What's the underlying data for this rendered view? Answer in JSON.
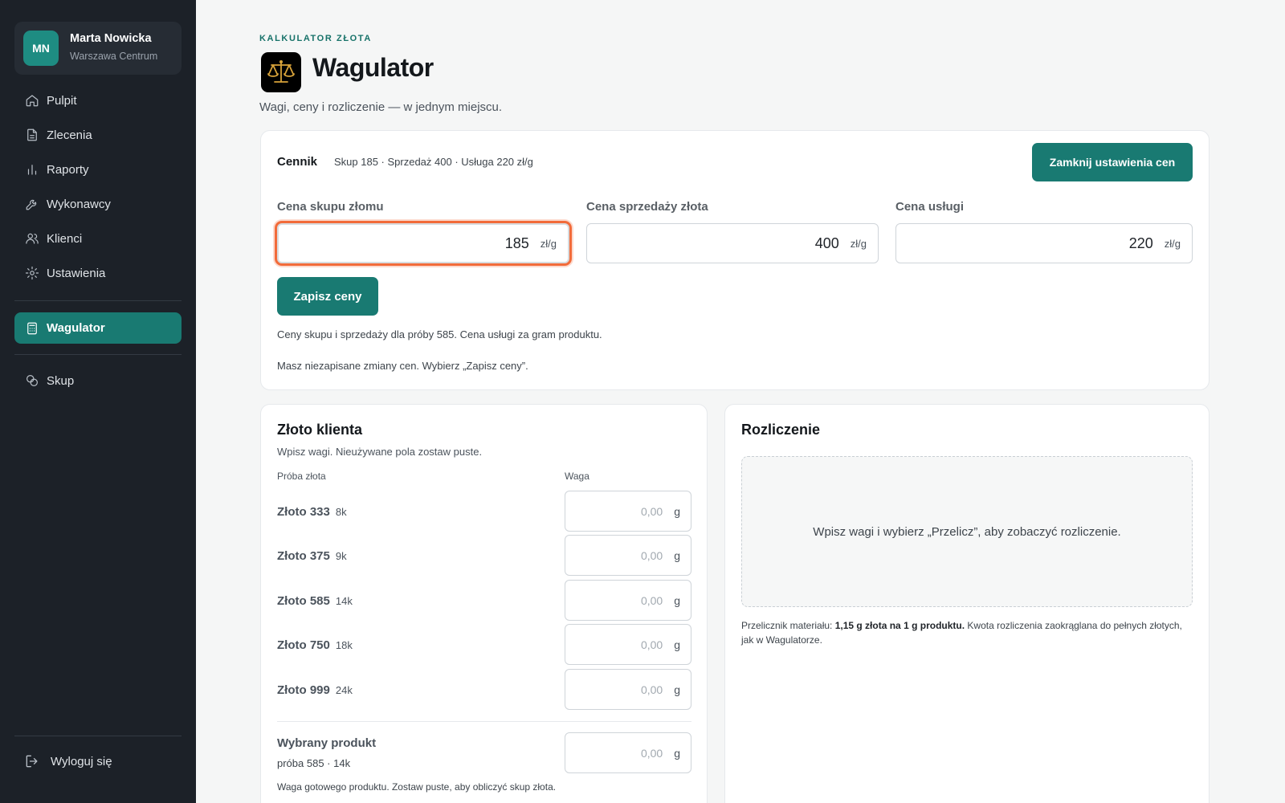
{
  "user": {
    "initials": "MN",
    "name": "Marta Nowicka",
    "location": "Warszawa Centrum"
  },
  "nav": {
    "items": [
      {
        "label": "Pulpit",
        "icon": "home-icon"
      },
      {
        "label": "Zlecenia",
        "icon": "document-icon"
      },
      {
        "label": "Raporty",
        "icon": "chart-icon"
      },
      {
        "label": "Wykonawcy",
        "icon": "wrench-icon"
      },
      {
        "label": "Klienci",
        "icon": "users-icon"
      },
      {
        "label": "Ustawienia",
        "icon": "gear-icon"
      }
    ],
    "active": {
      "label": "Wagulator",
      "icon": "calculator-icon"
    },
    "extra": {
      "label": "Skup",
      "icon": "coins-icon"
    },
    "logout": "Wyloguj się"
  },
  "header": {
    "eyebrow": "KALKULATOR ZŁOTA",
    "title": "Wagulator",
    "subtitle": "Wagi, ceny i rozliczenie — w jednym miejscu."
  },
  "prices": {
    "label": "Cennik",
    "summary": "Skup 185 · Sprzedaż 400 · Usługa 220 zł/g",
    "close_button": "Zamknij ustawienia cen",
    "fields": [
      {
        "label": "Cena skupu złomu",
        "value": "185",
        "unit": "zł/g"
      },
      {
        "label": "Cena sprzedaży złota",
        "value": "400",
        "unit": "zł/g"
      },
      {
        "label": "Cena usługi",
        "value": "220",
        "unit": "zł/g"
      }
    ],
    "save_button": "Zapisz ceny",
    "note": "Ceny skupu i sprzedaży dla próby 585. Cena usługi za gram produktu.",
    "unsaved": "Masz niezapisane zmiany cen. Wybierz „Zapisz ceny”."
  },
  "gold": {
    "title": "Złoto klienta",
    "subtitle": "Wpisz wagi. Nieużywane pola zostaw puste.",
    "col_assay": "Próba złota",
    "col_weight": "Waga",
    "rows": [
      {
        "name": "Złoto 333",
        "karat": "8k",
        "placeholder": "0,00",
        "unit": "g"
      },
      {
        "name": "Złoto 375",
        "karat": "9k",
        "placeholder": "0,00",
        "unit": "g"
      },
      {
        "name": "Złoto 585",
        "karat": "14k",
        "placeholder": "0,00",
        "unit": "g"
      },
      {
        "name": "Złoto 750",
        "karat": "18k",
        "placeholder": "0,00",
        "unit": "g"
      },
      {
        "name": "Złoto 999",
        "karat": "24k",
        "placeholder": "0,00",
        "unit": "g"
      }
    ],
    "product": {
      "name": "Wybrany produkt",
      "meta": "próba 585 · 14k",
      "placeholder": "0,00",
      "unit": "g",
      "note": "Waga gotowego produktu. Zostaw puste, aby obliczyć skup złota."
    }
  },
  "settlement": {
    "title": "Rozliczenie",
    "empty": "Wpisz wagi i wybierz „Przelicz”, aby zobaczyć rozliczenie.",
    "note_prefix": "Przelicznik materiału: ",
    "note_bold": "1,15 g złota na 1 g produktu.",
    "note_suffix": " Kwota rozliczenia zaokrąglana do pełnych złotych, jak w Wagulatorze."
  },
  "colors": {
    "accent": "#197a72",
    "sidebar": "#1c2128",
    "focus_ring": "#f26b3a"
  }
}
